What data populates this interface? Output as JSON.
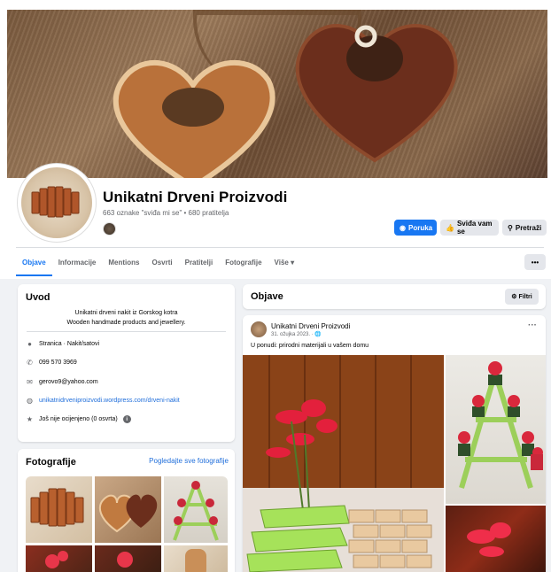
{
  "page": {
    "name": "Unikatni Drveni Proizvodi",
    "stats": "663 oznake \"sviđa mi se\" • 680 pratitelja"
  },
  "actions": {
    "message": "Poruka",
    "like": "Sviđa vam se",
    "search": "Pretraži",
    "more": "•••"
  },
  "tabs": [
    {
      "label": "Objave",
      "active": true
    },
    {
      "label": "Informacije"
    },
    {
      "label": "Mentions"
    },
    {
      "label": "Osvrti"
    },
    {
      "label": "Pratitelji"
    },
    {
      "label": "Fotografije"
    },
    {
      "label": "Više ▾"
    }
  ],
  "intro": {
    "title": "Uvod",
    "description_line1": "Unikatni drveni nakit iz Gorskog kotra",
    "description_line2": "Wooden handmade products and jewellery.",
    "category": "Stranica · Nakit/satovi",
    "phone": "099 570 3969",
    "email": "gerovo9@yahoo.com",
    "website": "unikatnidrveniproizvodi.wordpress.com/drveni-nakit",
    "rating": "Još nije ocijenjeno (0 osvrta)",
    "rating_info": "i"
  },
  "photos": {
    "title": "Fotografije",
    "see_all": "Pogledajte sve fotografije"
  },
  "posts": {
    "title": "Objave",
    "filters": "Filtri"
  },
  "post": {
    "author": "Unikatni Drveni Proizvodi",
    "date": "31. ožujka 2023. · 🌐",
    "text": "U ponudi: prirodni materijali u vašem domu",
    "menu": "···"
  },
  "icons": {
    "message": "messenger-icon",
    "like": "thumbs-up-icon",
    "search": "search-icon",
    "info": "info-icon",
    "phone": "phone-icon",
    "email": "envelope-icon",
    "web": "globe-icon",
    "star": "star-icon",
    "filter": "sliders-icon"
  },
  "colors": {
    "accent": "#1877f2",
    "link": "#216fdb",
    "background": "#f0f2f5"
  }
}
